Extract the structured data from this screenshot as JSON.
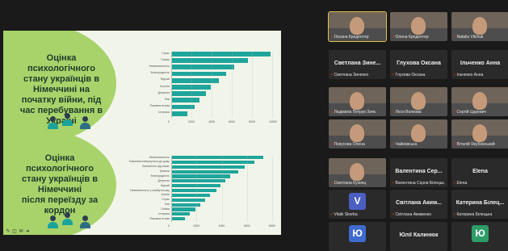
{
  "slide": {
    "top_heading": "Оцінка\nпсихологічного\nстану українців в\nНімеччині на\nпочатку війни, під\nчас перебування в\nУкраїні",
    "bottom_heading": "Оцінка\nпсихологічного\nстану українців в\nНімеччині\nпісля переїзду за\nкордон",
    "top_chart": {
      "labels": [
        "Страх",
        "Паніка",
        "Невизначеність",
        "Безпорадність",
        "Відчай",
        "Агресія",
        "Депресія",
        "Гнів",
        "Пасивна втома",
        "Істерика"
      ],
      "values": [
        9800,
        7600,
        6200,
        5400,
        4700,
        3900,
        3400,
        2800,
        2300,
        1600
      ],
      "ticks": [
        "0",
        "2000",
        "4000",
        "6000",
        "8000",
        "10000"
      ],
      "max": 10000
    },
    "bottom_chart": {
      "labels": [
        "Невизначеність",
        "Бажання повернутися до дому",
        "Залежність від інших",
        "Тривога",
        "Безпорадність",
        "Депресія",
        "Відчай",
        "Невпевненість у майбутньому",
        "Апатія",
        "Страх",
        "Гнів",
        "Паніка",
        "Істерика",
        "Пасивна втома"
      ],
      "values": [
        7300,
        6600,
        5800,
        5300,
        4700,
        4300,
        3900,
        3600,
        3100,
        2700,
        2300,
        1900,
        1500,
        1100
      ],
      "ticks": [
        "0",
        "2000",
        "4000",
        "6000",
        "8000"
      ],
      "max": 8000
    },
    "toolbar_icons": [
      "pen-icon",
      "eraser-icon",
      "mail-icon",
      "next-icon"
    ]
  },
  "participants": [
    {
      "name": "",
      "caption": "Оксана Кредентер",
      "kind": "photo",
      "active": true
    },
    {
      "name": "",
      "caption": "Олена Кредентер",
      "kind": "photo"
    },
    {
      "name": "",
      "caption": "Natalia Vilchuk",
      "kind": "photo"
    },
    {
      "name": "Светлана Зине...",
      "caption": "Светлана Зиненко",
      "kind": "name"
    },
    {
      "name": "Глухова Оксана",
      "caption": "Глухова Оксана",
      "kind": "name"
    },
    {
      "name": "Ільченко Анна",
      "caption": "Ільченко Анна",
      "kind": "name"
    },
    {
      "name": "",
      "caption": "Людмила Петрук-Зачк.",
      "kind": "photo"
    },
    {
      "name": "",
      "caption": "Леся Волкова",
      "kind": "photo"
    },
    {
      "name": "",
      "caption": "Сергій Царевич",
      "kind": "photo"
    },
    {
      "name": "",
      "caption": "Покусова Олена",
      "kind": "photo"
    },
    {
      "name": "",
      "caption": "Чайковська",
      "kind": "photo"
    },
    {
      "name": "",
      "caption": "Віталій Якубовський",
      "kind": "photo"
    },
    {
      "name": "",
      "caption": "Светлана Кузнец",
      "kind": "photo"
    },
    {
      "name": "Валентина Сер...",
      "caption": "Валентина Сєров Білецьк.",
      "kind": "name"
    },
    {
      "name": "Elena",
      "caption": "Elena",
      "kind": "name"
    },
    {
      "name": "",
      "avatar": "V",
      "caption": "Vitalii Skorba",
      "kind": "avatar",
      "color": "#4a5fc1"
    },
    {
      "name": "Світлана Аким...",
      "caption": "Світлана Акименко",
      "kind": "name"
    },
    {
      "name": "Катерина Білец...",
      "caption": "Катерина Білецька",
      "kind": "name"
    },
    {
      "name": "",
      "avatar": "Ю",
      "caption": "",
      "kind": "avatar",
      "color": "#3f6bd1"
    },
    {
      "name": "Юлії Калинюк",
      "caption": "",
      "kind": "name"
    },
    {
      "name": "",
      "avatar": "Ю",
      "caption": "",
      "kind": "avatar",
      "color": "#2e9c67"
    }
  ]
}
